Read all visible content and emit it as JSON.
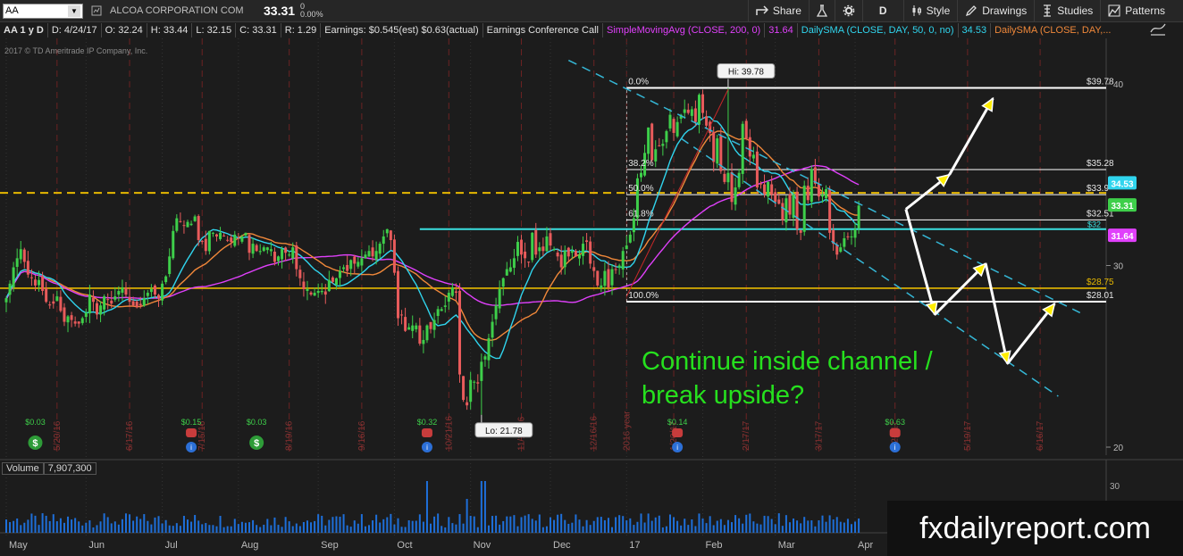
{
  "toolbar": {
    "symbol": "AA",
    "company": "ALCOA CORPORATION COM",
    "last": "33.31",
    "change": "0",
    "change_pct": "0.00%",
    "share": "Share",
    "period": "D",
    "style": "Style",
    "drawings": "Drawings",
    "studies": "Studies",
    "patterns": "Patterns"
  },
  "infobar": {
    "ticker_period": "AA 1 y D",
    "date": "D: 4/24/17",
    "open": "O: 32.24",
    "high": "H: 33.44",
    "low": "L: 32.15",
    "close": "C: 33.31",
    "range": "R: 1.29",
    "earnings": "Earnings: $0.545(est) $0.63(actual)",
    "conference": "Earnings Conference Call",
    "sma200_label": "SimpleMovingAvg (CLOSE, 200, 0)",
    "sma200_value": "31.64",
    "sma50_label": "DailySMA (CLOSE, DAY, 50, 0, no)",
    "sma50_value": "34.53",
    "sma20_label": "DailySMA (CLOSE, DAY,..."
  },
  "copyright": "2017 © TD Ameritrade IP Company, Inc.",
  "volume": {
    "label": "Volume",
    "value": "7,907,300"
  },
  "annotation": [
    "Continue inside channel /",
    "break upside?"
  ],
  "watermark": "fxdailyreport.com",
  "colors": {
    "sma200": "#e040fb",
    "sma50": "#30d5ee",
    "sma20": "#f0883a",
    "up": "#3ecf4a",
    "down": "#e85b5b",
    "channel": "#35b7d6",
    "fib": "#ffffff",
    "support": "#e6b800",
    "resistance": "#3ae0e0"
  },
  "chart_data": {
    "type": "candlestick",
    "title": "AA 1 y D",
    "y_ticks": [
      40,
      30,
      20
    ],
    "ylim": [
      19.6,
      40.2
    ],
    "x_month_labels": [
      "May",
      "Jun",
      "Jul",
      "Aug",
      "Sep",
      "Oct",
      "Nov",
      "Dec",
      "17",
      "Feb",
      "Mar",
      "Apr"
    ],
    "x_month_indices": [
      0,
      22,
      43,
      64,
      86,
      107,
      128,
      150,
      171,
      192,
      212,
      234
    ],
    "earnings_dates": [
      "5/20/16",
      "6/17/16",
      "7/15/16",
      "8/19/16",
      "9/16/16",
      "10/21/16",
      "11/18/16",
      "12/16/16",
      "2016 year",
      "1/20/17",
      "2/17/17",
      "3/17/17",
      "4/21/17",
      "5/19/17",
      "6/16/17"
    ],
    "earnings_date_indices": [
      14,
      34,
      54,
      78,
      98,
      122,
      142,
      162,
      171,
      184,
      204,
      224,
      245,
      265,
      285
    ],
    "events": [
      {
        "label": "$0.03",
        "idx": 8,
        "kind": "dividend"
      },
      {
        "label": "$0.15",
        "idx": 51,
        "kind": "earnings"
      },
      {
        "label": "$0.03",
        "idx": 69,
        "kind": "dividend"
      },
      {
        "label": "$0.32",
        "idx": 116,
        "kind": "earnings"
      },
      {
        "label": "$0.14",
        "idx": 185,
        "kind": "earnings"
      },
      {
        "label": "$0.63",
        "idx": 245,
        "kind": "earnings"
      }
    ],
    "high_marker": {
      "label": "Hi: 39.78",
      "idx": 199,
      "value": 39.78
    },
    "low_marker": {
      "label": "Lo: 21.78",
      "idx": 131,
      "value": 21.78
    },
    "price_badges": [
      {
        "label": "34.53",
        "value": 34.53,
        "color": "#30d5ee"
      },
      {
        "label": "33.31",
        "value": 33.31,
        "color": "#3ecf4a"
      },
      {
        "label": "31.64",
        "value": 31.64,
        "color": "#e040fb"
      }
    ],
    "fibonacci": [
      {
        "pct": "0.0%",
        "value": 39.78
      },
      {
        "pct": "38.2%",
        "value": 35.28
      },
      {
        "pct": "50.0%",
        "value": 33.9
      },
      {
        "pct": "61.8%",
        "value": 32.51
      },
      {
        "pct": "100.0%",
        "value": 28.01
      }
    ],
    "fib_price_labels": [
      "$39.78",
      "$35.28",
      "$33.9",
      "$32.51",
      "$28.01"
    ],
    "fib_start_idx": 171,
    "fib_end_idx": 296,
    "extra_levels": [
      {
        "label": "$28.75",
        "value": 28.75,
        "color": "#e6b800"
      },
      {
        "label": "$32",
        "value": 31.97,
        "color": "#3ae0e0"
      }
    ],
    "support_dashed": {
      "value": 34.0,
      "color": "#e6b800"
    },
    "resistance_line": {
      "value": 32.0,
      "start_idx": 114,
      "end_idx": 296,
      "color": "#3ae0e0"
    },
    "channel_upper": [
      [
        155,
        41.3
      ],
      [
        296,
        27.4
      ]
    ],
    "channel_lower": [
      [
        186,
        37.0
      ],
      [
        290,
        22.8
      ]
    ],
    "arrows_up_path": [
      [
        248,
        33.1
      ],
      [
        260,
        35.0
      ],
      [
        272,
        39.2
      ]
    ],
    "arrows_down_path": [
      [
        248,
        33.1
      ],
      [
        256,
        27.3
      ],
      [
        270,
        30.1
      ],
      [
        276,
        24.6
      ],
      [
        289,
        27.9
      ]
    ],
    "close": [
      28.2,
      29.0,
      29.9,
      30.4,
      30.9,
      30.2,
      29.5,
      29.3,
      28.9,
      29.2,
      28.6,
      28.0,
      27.8,
      27.9,
      28.3,
      27.5,
      26.9,
      27.2,
      27.0,
      26.8,
      26.8,
      27.1,
      27.4,
      28.4,
      28.0,
      27.3,
      27.8,
      28.3,
      28.1,
      27.9,
      28.3,
      28.6,
      28.8,
      28.4,
      28.0,
      27.8,
      27.7,
      27.8,
      28.2,
      28.5,
      28.7,
      28.4,
      28.2,
      29.0,
      29.4,
      30.5,
      31.9,
      32.6,
      32.4,
      32.2,
      32.4,
      32.3,
      32.7,
      31.4,
      31.3,
      30.8,
      31.9,
      31.8,
      31.6,
      31.8,
      31.6,
      31.4,
      31.3,
      31.7,
      31.5,
      31.6,
      31.8,
      30.7,
      31.2,
      30.8,
      30.8,
      31.0,
      31.0,
      30.9,
      30.2,
      30.5,
      30.9,
      30.7,
      30.6,
      31.0,
      29.8,
      29.3,
      28.7,
      28.7,
      28.4,
      28.5,
      28.6,
      28.6,
      28.4,
      29.2,
      29.1,
      29.3,
      29.7,
      29.9,
      29.7,
      30.3,
      30.1,
      30.2,
      30.4,
      30.6,
      30.8,
      30.5,
      30.8,
      31.2,
      31.6,
      32.0,
      31.4,
      29.6,
      27.1,
      27.3,
      26.4,
      26.6,
      26.7,
      26.7,
      25.7,
      25.9,
      26.7,
      26.5,
      27.0,
      27.6,
      27.6,
      27.8,
      28.5,
      28.8,
      28.5,
      24.0,
      22.6,
      22.3,
      23.7,
      23.6,
      23.5,
      24.7,
      25.0,
      26.0,
      26.9,
      27.8,
      28.7,
      29.3,
      29.8,
      29.9,
      30.4,
      31.3,
      30.6,
      30.4,
      30.2,
      31.8,
      30.6,
      31.0,
      30.8,
      31.6,
      31.1,
      30.9,
      30.5,
      29.9,
      30.8,
      30.5,
      30.8,
      30.5,
      30.6,
      31.2,
      31.3,
      30.1,
      29.7,
      28.9,
      28.9,
      29.7,
      28.8,
      29.8,
      29.8,
      30.0,
      30.8,
      31.1,
      31.7,
      32.6,
      34.8,
      35.1,
      36.2,
      37.6,
      35.8,
      36.4,
      36.6,
      36.7,
      37.4,
      38.3,
      37.3,
      37.9,
      38.3,
      38.6,
      38.4,
      38.6,
      37.9,
      39.4,
      38.4,
      37.7,
      37.3,
      35.7,
      37.0,
      35.2,
      34.6,
      35.1,
      33.5,
      34.3,
      35.1,
      37.8,
      37.0,
      36.0,
      36.1,
      34.3,
      34.5,
      33.9,
      34.6,
      33.9,
      33.5,
      33.4,
      32.5,
      33.7,
      32.8,
      33.9,
      32.0,
      31.8,
      34.4,
      33.6,
      35.3,
      34.5,
      33.8,
      33.9,
      34.2,
      31.8,
      31.2,
      30.6,
      31.0,
      31.5,
      31.6,
      31.6,
      32.0,
      33.3
    ],
    "volume_note": "daily volume histogram (relative heights)",
    "volume_y_tick": "30"
  }
}
